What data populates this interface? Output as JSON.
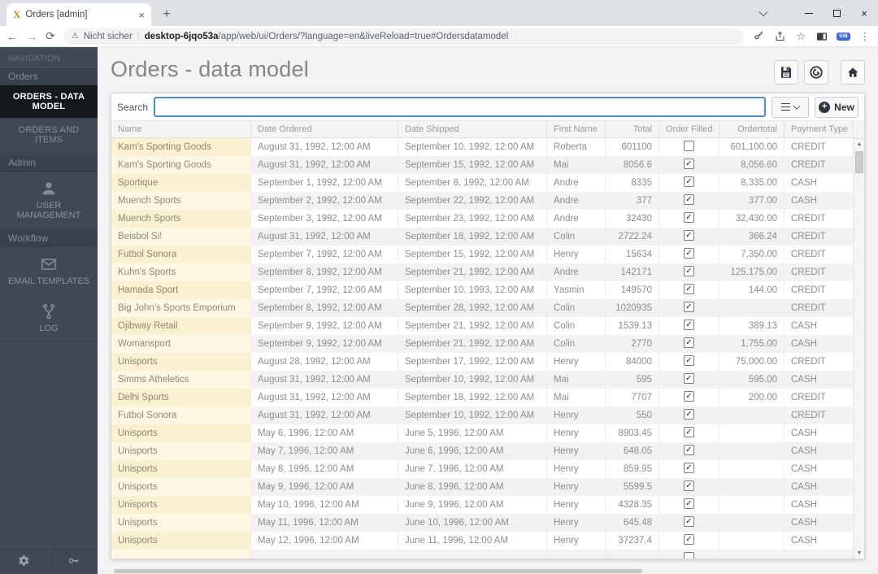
{
  "browser": {
    "tab_title": "Orders [admin]",
    "favicon_letter": "X",
    "security_text": "Nicht sicher",
    "url_host": "desktop-6jqo53a",
    "url_path": "/app/web/ui/Orders/?language=en&liveReload=true#Ordersdatamodel",
    "extension_label": "SIB"
  },
  "icons": {
    "back": "←",
    "forward": "→",
    "reload": "⟳",
    "warning": "⚠",
    "star": "☆",
    "kebab": "⋮",
    "close": "×",
    "tab_close": "×",
    "new_tab": "+",
    "up_arrow": "▲",
    "down_arrow": "▼",
    "check": "✓",
    "plus": "+"
  },
  "sidebar": {
    "nav_label": "NAVIGATION",
    "items": [
      {
        "type": "section",
        "label": "Orders"
      },
      {
        "type": "active",
        "label": "ORDERS - DATA MODEL"
      },
      {
        "type": "item",
        "label": "ORDERS AND ITEMS"
      },
      {
        "type": "section",
        "label": "Admin"
      },
      {
        "type": "icon-item",
        "icon": "user-icon",
        "label": "USER MANAGEMENT"
      },
      {
        "type": "section",
        "label": "Workflow"
      },
      {
        "type": "icon-item",
        "icon": "envelope-icon",
        "label": "EMAIL TEMPLATES"
      },
      {
        "type": "icon-item",
        "icon": "branch-icon",
        "label": "LOG"
      }
    ]
  },
  "header": {
    "title": "Orders - data model"
  },
  "toolbar": {
    "search_label": "Search",
    "search_value": "",
    "new_label": "New"
  },
  "table": {
    "columns": [
      {
        "label": "Name",
        "key": "name"
      },
      {
        "label": "Date Ordered",
        "key": "date_ordered"
      },
      {
        "label": "Date Shipped",
        "key": "date_shipped"
      },
      {
        "label": "First Name",
        "key": "first_name"
      },
      {
        "label": "Total",
        "key": "total",
        "align": "right"
      },
      {
        "label": "Order Filled",
        "key": "order_filled",
        "align": "center",
        "type": "checkbox"
      },
      {
        "label": "Ordertotal",
        "key": "ordertotal",
        "align": "right"
      },
      {
        "label": "Payment Type",
        "key": "payment_type"
      }
    ],
    "rows": [
      {
        "name": "Kam's Sporting Goods",
        "date_ordered": "August 31, 1992, 12:00 AM",
        "date_shipped": "September 10, 1992, 12:00 AM",
        "first_name": "Roberta",
        "total": "601100",
        "order_filled": false,
        "ordertotal": "601,100.00",
        "payment_type": "CREDIT"
      },
      {
        "name": "Kam's Sporting Goods",
        "date_ordered": "August 31, 1992, 12:00 AM",
        "date_shipped": "September 15, 1992, 12:00 AM",
        "first_name": "Mai",
        "total": "8056.6",
        "order_filled": true,
        "ordertotal": "8,056.60",
        "payment_type": "CREDIT"
      },
      {
        "name": "Sportique",
        "date_ordered": "September 1, 1992, 12:00 AM",
        "date_shipped": "September 8, 1992, 12:00 AM",
        "first_name": "Andre",
        "total": "8335",
        "order_filled": true,
        "ordertotal": "8,335.00",
        "payment_type": "CASH"
      },
      {
        "name": "Muench Sports",
        "date_ordered": "September 2, 1992, 12:00 AM",
        "date_shipped": "September 22, 1992, 12:00 AM",
        "first_name": "Andre",
        "total": "377",
        "order_filled": true,
        "ordertotal": "377.00",
        "payment_type": "CASH"
      },
      {
        "name": "Muench Sports",
        "date_ordered": "September 3, 1992, 12:00 AM",
        "date_shipped": "September 23, 1992, 12:00 AM",
        "first_name": "Andre",
        "total": "32430",
        "order_filled": true,
        "ordertotal": "32,430.00",
        "payment_type": "CREDIT"
      },
      {
        "name": "Beisbol Si!",
        "date_ordered": "August 31, 1992, 12:00 AM",
        "date_shipped": "September 18, 1992, 12:00 AM",
        "first_name": "Colin",
        "total": "2722.24",
        "order_filled": true,
        "ordertotal": "366.24",
        "payment_type": "CREDIT"
      },
      {
        "name": "Futbol Sonora",
        "date_ordered": "September 7, 1992, 12:00 AM",
        "date_shipped": "September 15, 1992, 12:00 AM",
        "first_name": "Henry",
        "total": "15634",
        "order_filled": true,
        "ordertotal": "7,350.00",
        "payment_type": "CREDIT"
      },
      {
        "name": "Kuhn's Sports",
        "date_ordered": "September 8, 1992, 12:00 AM",
        "date_shipped": "September 21, 1992, 12:00 AM",
        "first_name": "Andre",
        "total": "142171",
        "order_filled": true,
        "ordertotal": "125,175.00",
        "payment_type": "CREDIT"
      },
      {
        "name": "Hamada Sport",
        "date_ordered": "September 7, 1992, 12:00 AM",
        "date_shipped": "September 10, 1993, 12:00 AM",
        "first_name": "Yasmin",
        "total": "149570",
        "order_filled": true,
        "ordertotal": "144.00",
        "payment_type": "CREDIT"
      },
      {
        "name": "Big John's Sports Emporium",
        "date_ordered": "September 8, 1992, 12:00 AM",
        "date_shipped": "September 28, 1992, 12:00 AM",
        "first_name": "Colin",
        "total": "1020935",
        "order_filled": true,
        "ordertotal": "",
        "payment_type": "CREDIT"
      },
      {
        "name": "Ojibway Retail",
        "date_ordered": "September 9, 1992, 12:00 AM",
        "date_shipped": "September 21, 1992, 12:00 AM",
        "first_name": "Colin",
        "total": "1539.13",
        "order_filled": true,
        "ordertotal": "389.13",
        "payment_type": "CASH"
      },
      {
        "name": "Womansport",
        "date_ordered": "September 9, 1992, 12:00 AM",
        "date_shipped": "September 21, 1992, 12:00 AM",
        "first_name": "Colin",
        "total": "2770",
        "order_filled": true,
        "ordertotal": "1,755.00",
        "payment_type": "CASH"
      },
      {
        "name": "Unisports",
        "date_ordered": "August 28, 1992, 12:00 AM",
        "date_shipped": "September 17, 1992, 12:00 AM",
        "first_name": "Henry",
        "total": "84000",
        "order_filled": true,
        "ordertotal": "75,000.00",
        "payment_type": "CREDIT"
      },
      {
        "name": "Simms Atheletics",
        "date_ordered": "August 31, 1992, 12:00 AM",
        "date_shipped": "September 10, 1992, 12:00 AM",
        "first_name": "Mai",
        "total": "595",
        "order_filled": true,
        "ordertotal": "595.00",
        "payment_type": "CASH"
      },
      {
        "name": "Delhi Sports",
        "date_ordered": "August 31, 1992, 12:00 AM",
        "date_shipped": "September 18, 1992, 12:00 AM",
        "first_name": "Mai",
        "total": "7707",
        "order_filled": true,
        "ordertotal": "200.00",
        "payment_type": "CREDIT"
      },
      {
        "name": "Futbol Sonora",
        "date_ordered": "August 31, 1992, 12:00 AM",
        "date_shipped": "September 10, 1992, 12:00 AM",
        "first_name": "Henry",
        "total": "550",
        "order_filled": true,
        "ordertotal": "",
        "payment_type": "CREDIT"
      },
      {
        "name": "Unisports",
        "date_ordered": "May 6, 1996, 12:00 AM",
        "date_shipped": "June 5, 1996, 12:00 AM",
        "first_name": "Henry",
        "total": "8903.45",
        "order_filled": true,
        "ordertotal": "",
        "payment_type": "CASH"
      },
      {
        "name": "Unisports",
        "date_ordered": "May 7, 1996, 12:00 AM",
        "date_shipped": "June 6, 1996, 12:00 AM",
        "first_name": "Henry",
        "total": "648.05",
        "order_filled": true,
        "ordertotal": "",
        "payment_type": "CASH"
      },
      {
        "name": "Unisports",
        "date_ordered": "May 8, 1996, 12:00 AM",
        "date_shipped": "June 7, 1996, 12:00 AM",
        "first_name": "Henry",
        "total": "859.95",
        "order_filled": true,
        "ordertotal": "",
        "payment_type": "CASH"
      },
      {
        "name": "Unisports",
        "date_ordered": "May 9, 1996, 12:00 AM",
        "date_shipped": "June 8, 1996, 12:00 AM",
        "first_name": "Henry",
        "total": "5599.5",
        "order_filled": true,
        "ordertotal": "",
        "payment_type": "CASH"
      },
      {
        "name": "Unisports",
        "date_ordered": "May 10, 1996, 12:00 AM",
        "date_shipped": "June 9, 1996, 12:00 AM",
        "first_name": "Henry",
        "total": "4328.35",
        "order_filled": true,
        "ordertotal": "",
        "payment_type": "CASH"
      },
      {
        "name": "Unisports",
        "date_ordered": "May 11, 1996, 12:00 AM",
        "date_shipped": "June 10, 1996, 12:00 AM",
        "first_name": "Henry",
        "total": "645.48",
        "order_filled": true,
        "ordertotal": "",
        "payment_type": "CASH"
      },
      {
        "name": "Unisports",
        "date_ordered": "May 12, 1996, 12:00 AM",
        "date_shipped": "June 11, 1996, 12:00 AM",
        "first_name": "Henry",
        "total": "37237.4",
        "order_filled": true,
        "ordertotal": "",
        "payment_type": "CASH"
      },
      {
        "name": "",
        "date_ordered": "",
        "date_shipped": "",
        "first_name": "",
        "total": "",
        "order_filled": false,
        "ordertotal": "",
        "payment_type": ""
      }
    ]
  }
}
